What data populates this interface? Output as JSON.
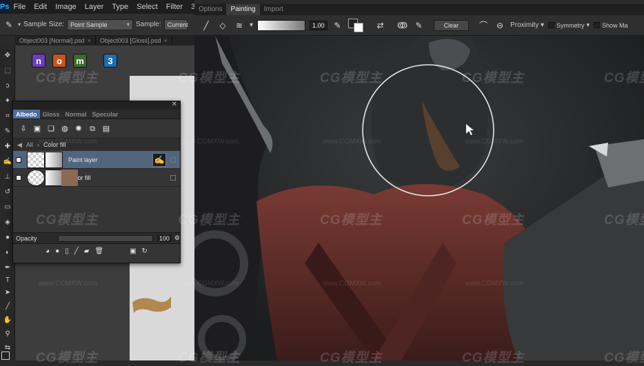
{
  "app": {
    "logo": "Ps"
  },
  "menu": [
    "File",
    "Edit",
    "Image",
    "Layer",
    "Type",
    "Select",
    "Filter",
    "3"
  ],
  "options_bar": {
    "sample_size_label": "Sample Size:",
    "sample_size_value": "Point Sample",
    "sample_label": "Sample:",
    "sample_value": "Current"
  },
  "doc_tabs": [
    {
      "name": "Object003 [Normal].psd"
    },
    {
      "name": "Object003 [Gloss].psd"
    }
  ],
  "app_icons": [
    {
      "letter": "n",
      "color": "#6a3fb8"
    },
    {
      "letter": "o",
      "color": "#c8551a"
    },
    {
      "letter": "m",
      "color": "#3d6b2d"
    },
    {
      "letter": "3",
      "color": "#1d6fb0"
    }
  ],
  "layers_panel": {
    "tabs": [
      "Albedo",
      "Gloss",
      "Normal",
      "Specular"
    ],
    "active_tab": "Albedo",
    "path_root": "All",
    "path_current": "Color fill",
    "layers": [
      {
        "name": "Paint layer",
        "selected": true
      },
      {
        "name": "Color fill",
        "selected": false,
        "fill_color": "#8a6a55"
      }
    ],
    "opacity_label": "Opacity",
    "opacity_value": "100"
  },
  "painting_panel": {
    "tabs": [
      "Options",
      "Painting",
      "Import"
    ],
    "active_tab": "Painting",
    "brush_size": "1.00",
    "clear_label": "Clear",
    "proximity_label": "Proximity",
    "symmetry_label": "Symmetry",
    "show_label": "Show Ma"
  },
  "watermark": {
    "logo": "CG模型主",
    "url": "www.CGMXW.com"
  }
}
